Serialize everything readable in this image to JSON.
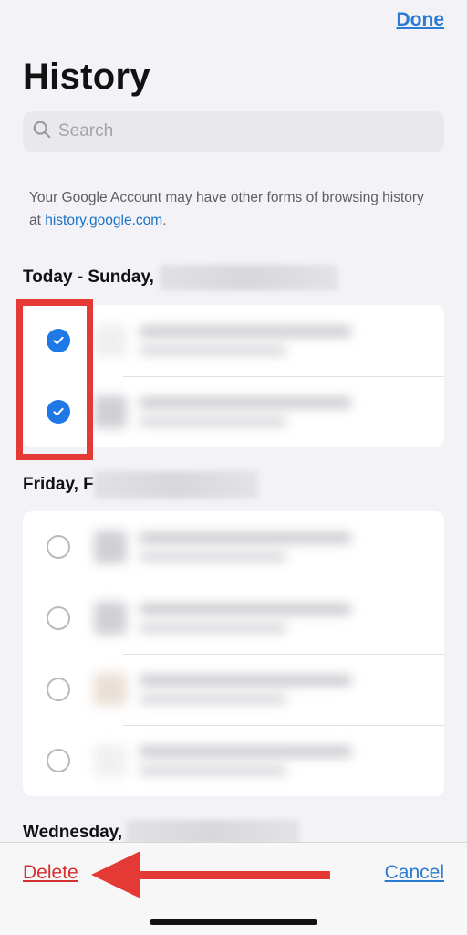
{
  "header": {
    "done_label": "Done",
    "title": "History"
  },
  "search": {
    "placeholder": "Search"
  },
  "note": {
    "text": "Your Google Account may have other forms of browsing history at ",
    "link": "history.google.com",
    "suffix": "."
  },
  "sections": [
    {
      "label": "Today - Sunday,",
      "items": [
        {
          "selected": true
        },
        {
          "selected": true
        }
      ]
    },
    {
      "label": "Friday, F",
      "items": [
        {
          "selected": false
        },
        {
          "selected": false
        },
        {
          "selected": false
        },
        {
          "selected": false
        }
      ]
    },
    {
      "label": "Wednesday,"
    }
  ],
  "footer": {
    "delete_label": "Delete",
    "cancel_label": "Cancel"
  },
  "colors": {
    "accent": "#2a7bd3",
    "delete": "#d32f2f",
    "checkmark": "#1e78e6",
    "annotation": "#e53935"
  },
  "icons": {
    "search": "search-icon",
    "selected": "checkmark-circle-icon",
    "unselected": "empty-circle-icon"
  }
}
